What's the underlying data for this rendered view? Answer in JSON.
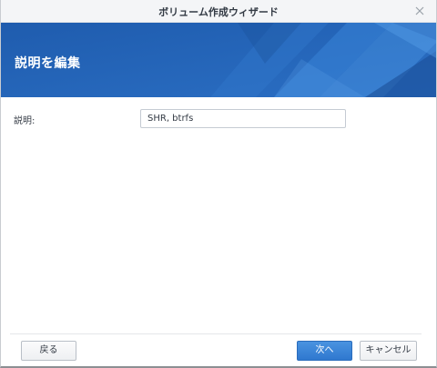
{
  "window": {
    "title": "ボリューム作成ウィザード",
    "close_icon": "close-icon"
  },
  "banner": {
    "title": "説明を編集",
    "colors": {
      "base": "#2a66b5",
      "light": "#3f86d8",
      "dark": "#1a4f98"
    }
  },
  "form": {
    "description_label": "説明:",
    "description_value": "SHR, btrfs"
  },
  "footer": {
    "back_label": "戻る",
    "next_label": "次へ",
    "cancel_label": "キャンセル"
  },
  "colors": {
    "accent": "#2f78cf",
    "titlebar_bg": "#f4f5f7"
  }
}
